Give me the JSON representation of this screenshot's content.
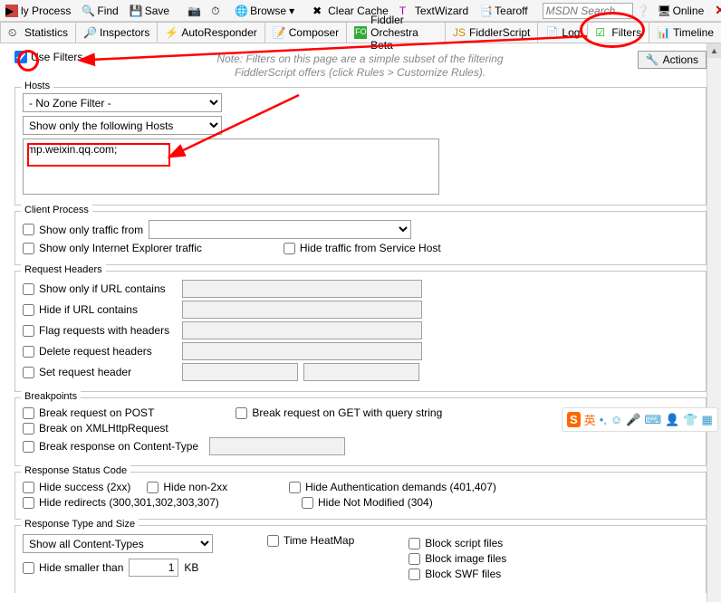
{
  "toolbar": {
    "items": [
      "ly Process",
      "Find",
      "Save",
      "",
      "",
      "Browse",
      "",
      "Clear Cache",
      "TextWizard",
      "Tearoff"
    ],
    "msdn_placeholder": "MSDN Search...",
    "online": "Online"
  },
  "tabs": [
    "Statistics",
    "Inspectors",
    "AutoResponder",
    "Composer",
    "Fiddler Orchestra Beta",
    "FiddlerScript",
    "Log",
    "Filters",
    "Timeline"
  ],
  "top": {
    "use_filters": "Use Filters",
    "note_line1": "Note: Filters on this page are a simple subset of the filtering",
    "note_line2": "FiddlerScript offers (click Rules > Customize Rules).",
    "actions": "Actions"
  },
  "hosts": {
    "legend": "Hosts",
    "zone": "- No Zone Filter -",
    "mode": "Show only the following Hosts",
    "text": "mp.weixin.qq.com;"
  },
  "client": {
    "legend": "Client Process",
    "show_from": "Show only traffic from",
    "ie": "Show only Internet Explorer traffic",
    "hide_svc": "Hide traffic from Service Host"
  },
  "reqh": {
    "legend": "Request Headers",
    "show_url": "Show only if URL contains",
    "hide_url": "Hide if URL contains",
    "flag": "Flag requests with headers",
    "delete": "Delete request headers",
    "set": "Set request header"
  },
  "bp": {
    "legend": "Breakpoints",
    "post": "Break request on POST",
    "get": "Break request on GET with query string",
    "xhr": "Break on XMLHttpRequest",
    "ct": "Break response on Content-Type"
  },
  "status": {
    "legend": "Response Status Code",
    "s2xx": "Hide success (2xx)",
    "n2xx": "Hide non-2xx",
    "auth": "Hide Authentication demands (401,407)",
    "redir": "Hide redirects (300,301,302,303,307)",
    "nm": "Hide Not Modified (304)"
  },
  "rtype": {
    "legend": "Response Type and Size",
    "ct": "Show all Content-Types",
    "time": "Time HeatMap",
    "bscript": "Block script files",
    "bimg": "Block image files",
    "bswf": "Block SWF files",
    "smaller": "Hide smaller than",
    "smaller_val": "1",
    "kb": "KB"
  }
}
